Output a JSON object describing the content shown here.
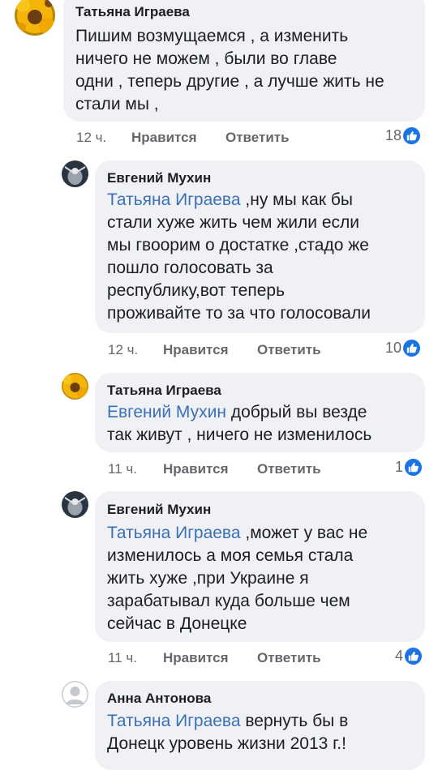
{
  "comments": [
    {
      "author": "Татьяна Играева",
      "avatar": "sunflower-avatar",
      "mention": "",
      "lines": [
        "Пишим возмущаемся , а изменить",
        "ничего не можем , были во главе",
        "одни , теперь другие , а лучше жить не",
        "стали мы ,"
      ],
      "time": "12 ч.",
      "like_label": "Нравится",
      "reply_label": "Ответить",
      "likes": "18"
    },
    {
      "author": "Евгений Мухин",
      "avatar": "dark-avatar",
      "mention": "Татьяна Играева",
      "lines": [
        " ,ну мы как бы",
        "стали хуже жить чем жили если",
        "мы гвоорим о достатке ,стадо же",
        "пошло голосовать за",
        "республику,вот теперь",
        "проживайте то за что голосовали"
      ],
      "time": "12 ч.",
      "like_label": "Нравится",
      "reply_label": "Ответить",
      "likes": "10"
    },
    {
      "author": "Татьяна Играева",
      "avatar": "sunflower-avatar",
      "mention": "Евгений Мухин",
      "lines": [
        " добрый вы везде",
        "так живут , ничего не изменилось"
      ],
      "time": "11 ч.",
      "like_label": "Нравится",
      "reply_label": "Ответить",
      "likes": "1"
    },
    {
      "author": "Евгений Мухин",
      "avatar": "dark-avatar",
      "mention": "Татьяна Играева",
      "lines": [
        " ,может у вас не",
        "изменилось а моя семья стала",
        "жить хуже ,при Украине я",
        "зарабатывал куда больше чем",
        "сейчас в Донецке"
      ],
      "time": "11 ч.",
      "like_label": "Нравится",
      "reply_label": "Ответить",
      "likes": "4"
    },
    {
      "author": "Анна Антонова",
      "avatar": "default-avatar",
      "mention": "Татьяна Играева",
      "lines": [
        " вернуть бы  в",
        "Донецк уровень жизни 2013 г.!"
      ],
      "time": "",
      "like_label": "",
      "reply_label": "",
      "likes": ""
    }
  ],
  "colors": {
    "bubble": "#eff1f4",
    "mention": "#3b6fb6",
    "meta": "#65676b",
    "like_badge": "#1b74e4"
  }
}
